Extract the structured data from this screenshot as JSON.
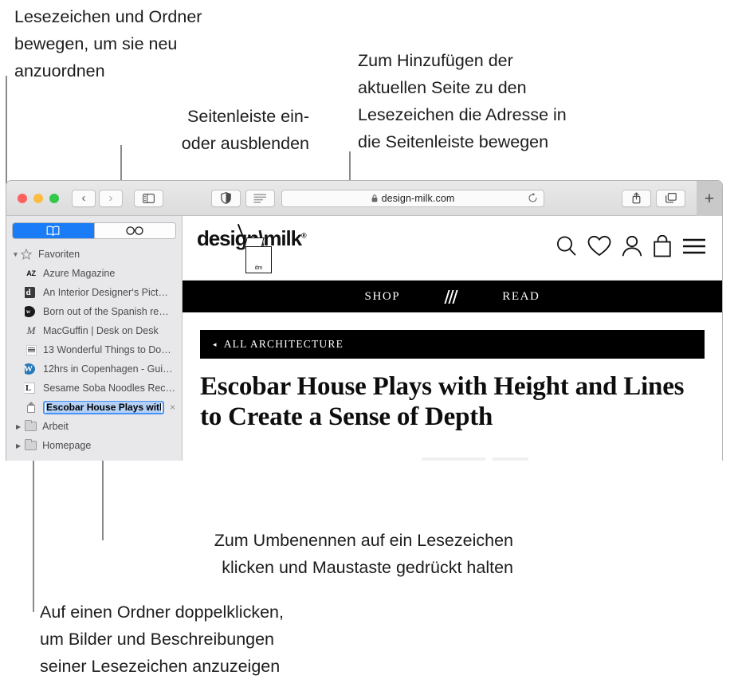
{
  "callouts": [
    {
      "id": "reorder",
      "text": "Lesezeichen und Ordner\nbewegen, um sie neu\nanzuordnen"
    },
    {
      "id": "sidebar-toggle",
      "text": "Seitenleiste ein-\noder ausblenden"
    },
    {
      "id": "add-bookmark",
      "text": "Zum Hinzufügen der\naktuellen Seite zu den\nLesezeichen die Adresse in\ndie Seitenleiste bewegen"
    },
    {
      "id": "rename",
      "text": "Zum Umbenennen auf ein Lesezeichen\nklicken und Maustaste gedrückt halten"
    },
    {
      "id": "folder-dblclick",
      "text": "Auf einen Ordner doppelklicken,\num Bilder und Beschreibungen\nseiner Lesezeichen anzuzeigen"
    }
  ],
  "window": {
    "traffic_lights": {
      "close": "close",
      "minimize": "minimize",
      "zoom": "zoom"
    },
    "toolbar": {
      "back_glyph": "‹",
      "forward_glyph": "›",
      "sidebar_icon": "sidebar-icon",
      "privacy_icon": "shield-icon",
      "reader_icon": "reader-view-icon",
      "share_icon": "share-icon",
      "tabs_icon": "tab-overview-icon",
      "new_tab_glyph": "+",
      "url": "design-milk.com",
      "lock_glyph": "🔒",
      "reload_glyph": "↻"
    }
  },
  "sidebar": {
    "segments": [
      {
        "name": "bookmarks",
        "icon": "book-icon",
        "selected": true
      },
      {
        "name": "reading-list",
        "icon": "glasses-icon",
        "selected": false
      }
    ],
    "groups": [
      {
        "label": "Favoriten",
        "icon": "star-icon",
        "expanded": true,
        "items": [
          {
            "label": "Azure Magazine",
            "favicon": "az-favicon"
          },
          {
            "label": "An Interior Designer‘s Pict…",
            "favicon": "d-favicon"
          },
          {
            "label": "Born out of the Spanish re…",
            "favicon": "circle-favicon"
          },
          {
            "label": "MacGuffin | Desk on Desk",
            "favicon": "m-favicon"
          },
          {
            "label": "13 Wonderful Things to Do…",
            "favicon": "grid-favicon"
          },
          {
            "label": "12hrs in Copenhagen - Gui…",
            "favicon": "wordpress-favicon"
          },
          {
            "label": "Sesame Soba Noodles Rec…",
            "favicon": "l-favicon"
          }
        ]
      }
    ],
    "editing_item": {
      "favicon": "milk-carton-favicon",
      "value": "Escobar House Plays with ",
      "clear_glyph": "×"
    },
    "folders": [
      {
        "label": "Arbeit",
        "icon": "folder-icon",
        "disclosure": "▶"
      },
      {
        "label": "Homepage",
        "icon": "folder-icon",
        "disclosure": "▶"
      }
    ]
  },
  "page": {
    "logo": {
      "text_left": "design",
      "slash": "\\",
      "text_right": "milk",
      "registered": "®",
      "carton_label": "dm"
    },
    "header_icons": [
      "search-icon",
      "heart-icon",
      "account-icon",
      "bag-icon",
      "menu-icon"
    ],
    "nav": [
      {
        "label": "SHOP"
      },
      {
        "label": "slashes-divider"
      },
      {
        "label": "READ"
      }
    ],
    "breadcrumb": {
      "arrow": "◂",
      "label": "ALL ARCHITECTURE"
    },
    "headline": "Escobar House Plays with Height and Lines to Create a Sense of Depth"
  },
  "colors": {
    "accent_blue": "#1a7cf7",
    "selection_blue": "#b3d0f7",
    "sidebar_bg": "#e8e8ea",
    "nav_black": "#000000",
    "light_red": "#fc615d",
    "light_yellow": "#fdbc40",
    "light_green": "#34c84a"
  }
}
